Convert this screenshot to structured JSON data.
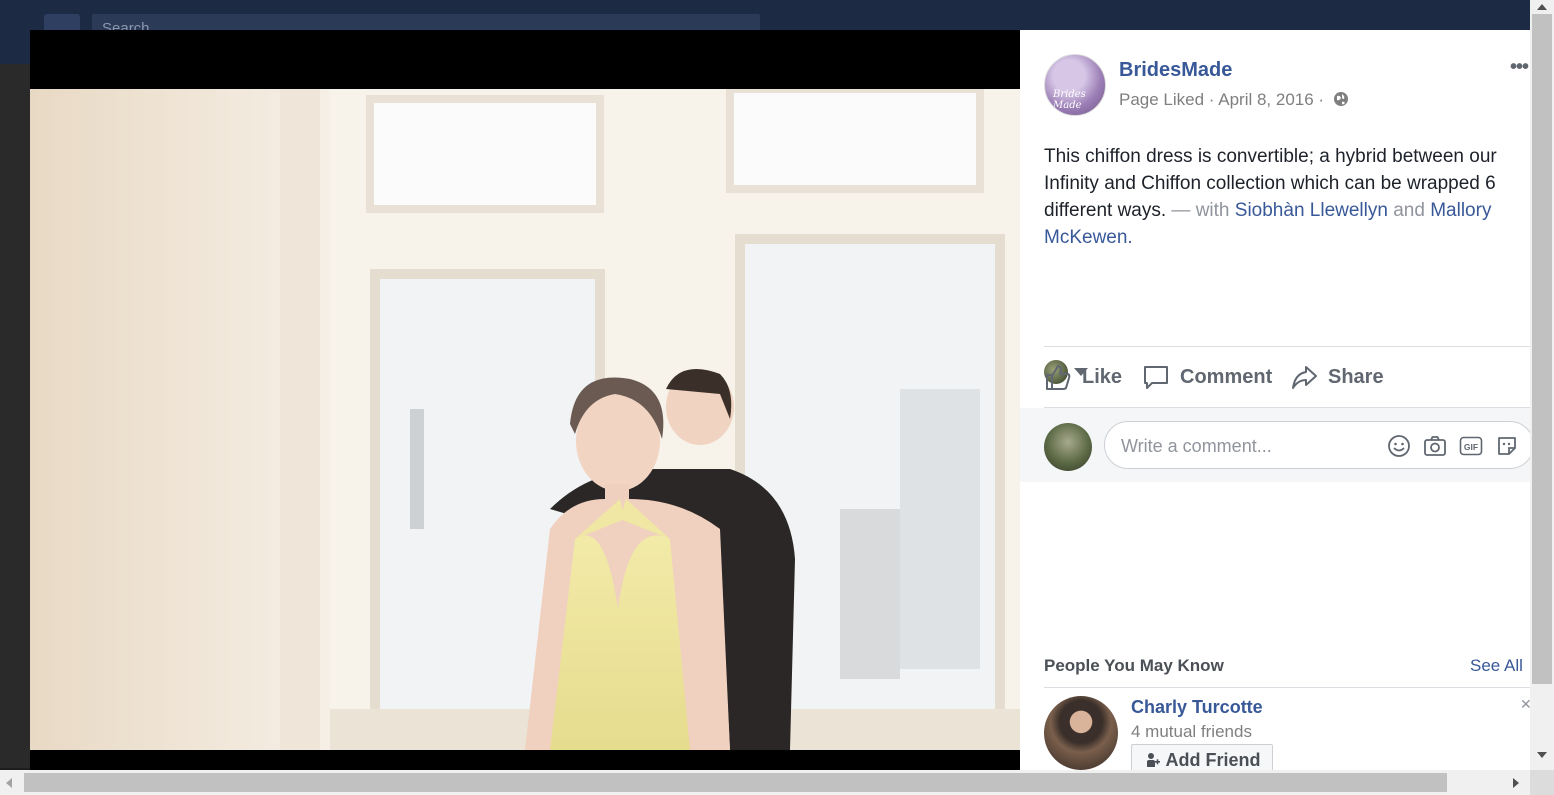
{
  "background": {
    "search_placeholder": "Search"
  },
  "post": {
    "page_name": "BridesMade",
    "avatar_label": "Brides Made",
    "meta": "Page Liked · April 8, 2016 ·",
    "text": "This chiffon dress is convertible; a hybrid between our Infinity and Chiffon collection which can be wrapped 6 different ways.",
    "with_prefix": " — with ",
    "tag_1": "Siobhàn Llewellyn",
    "and_word": "and",
    "tag_2": "Mallory McKewen",
    "period": "."
  },
  "actions": {
    "like": "Like",
    "comment": "Comment",
    "share": "Share"
  },
  "comment_input": {
    "placeholder": "Write a comment..."
  },
  "pymk": {
    "title": "People You May Know",
    "see_all": "See All",
    "person": {
      "name": "Charly Turcotte",
      "mutual": "4 mutual friends",
      "add_label": "Add Friend"
    }
  },
  "icons": [
    "globe-icon",
    "like-icon",
    "comment-icon",
    "share-icon",
    "emoji-icon",
    "camera-icon",
    "gif-icon",
    "sticker-icon",
    "add-friend-icon"
  ],
  "colors": {
    "link": "#385898",
    "muted": "#7f7f7f",
    "text": "#1d2129"
  }
}
